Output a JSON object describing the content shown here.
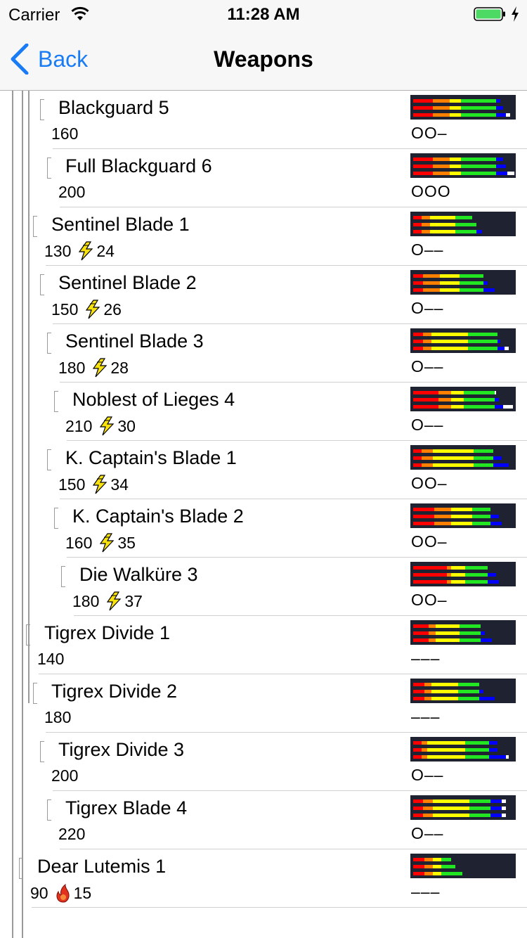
{
  "status_bar": {
    "carrier": "Carrier",
    "time": "11:28 AM"
  },
  "nav": {
    "back_label": "Back",
    "title": "Weapons"
  },
  "sharpness_colors": [
    "#ff0000",
    "#ff7f00",
    "#ffff00",
    "#22e622",
    "#0000ff",
    "#ffffff",
    "#ffffff"
  ],
  "weapons": [
    {
      "name": "",
      "attack": "140",
      "slots": "OO–",
      "indent": 4,
      "bonus_type": "",
      "bonus_value": "",
      "sharpness": [
        [
          0,
          0,
          0,
          0,
          0,
          0
        ],
        [
          0,
          0,
          0,
          0,
          0,
          0
        ],
        [
          0,
          0,
          0,
          0,
          0,
          0
        ]
      ]
    },
    {
      "name": "Blackguard 5",
      "attack": "160",
      "slots": "OO–",
      "indent": 5,
      "bonus_type": "",
      "bonus_value": "",
      "sharpness": [
        [
          28,
          24,
          16,
          50,
          6,
          0
        ],
        [
          28,
          24,
          16,
          50,
          10,
          0
        ],
        [
          28,
          24,
          16,
          50,
          14,
          6
        ]
      ]
    },
    {
      "name": "Full Blackguard 6",
      "attack": "200",
      "slots": "OOO",
      "indent": 6,
      "bonus_type": "",
      "bonus_value": "",
      "sharpness": [
        [
          28,
          24,
          16,
          50,
          10,
          0
        ],
        [
          28,
          24,
          16,
          50,
          14,
          0
        ],
        [
          28,
          24,
          16,
          50,
          16,
          10
        ]
      ]
    },
    {
      "name": "Sentinel Blade 1",
      "attack": "130",
      "slots": "O––",
      "indent": 4,
      "bonus_type": "thunder",
      "bonus_value": "24",
      "sharpness": [
        [
          12,
          12,
          36,
          24,
          0,
          0
        ],
        [
          12,
          12,
          36,
          30,
          0,
          0
        ],
        [
          12,
          12,
          36,
          30,
          8,
          0
        ]
      ]
    },
    {
      "name": "Sentinel Blade 2",
      "attack": "150",
      "slots": "O––",
      "indent": 5,
      "bonus_type": "thunder",
      "bonus_value": "26",
      "sharpness": [
        [
          14,
          24,
          28,
          34,
          0,
          0
        ],
        [
          14,
          24,
          28,
          34,
          6,
          0
        ],
        [
          14,
          24,
          28,
          34,
          16,
          0
        ]
      ]
    },
    {
      "name": "Sentinel Blade 3",
      "attack": "180",
      "slots": "O––",
      "indent": 6,
      "bonus_type": "thunder",
      "bonus_value": "28",
      "sharpness": [
        [
          14,
          12,
          52,
          42,
          0,
          0
        ],
        [
          14,
          12,
          52,
          42,
          4,
          0
        ],
        [
          14,
          12,
          52,
          42,
          10,
          6
        ]
      ]
    },
    {
      "name": "Noblest of Lieges 4",
      "attack": "210",
      "slots": "O––",
      "indent": 7,
      "bonus_type": "thunder",
      "bonus_value": "30",
      "sharpness": [
        [
          36,
          18,
          18,
          44,
          0,
          2
        ],
        [
          36,
          18,
          18,
          44,
          6,
          0
        ],
        [
          36,
          18,
          18,
          44,
          12,
          14
        ]
      ]
    },
    {
      "name": "K. Captain's Blade 1",
      "attack": "150",
      "slots": "OO–",
      "indent": 6,
      "bonus_type": "thunder",
      "bonus_value": "34",
      "sharpness": [
        [
          12,
          16,
          58,
          28,
          0,
          0
        ],
        [
          12,
          16,
          58,
          28,
          12,
          0
        ],
        [
          12,
          16,
          58,
          28,
          22,
          0
        ]
      ]
    },
    {
      "name": "K. Captain's Blade 2",
      "attack": "160",
      "slots": "OO–",
      "indent": 7,
      "bonus_type": "thunder",
      "bonus_value": "35",
      "sharpness": [
        [
          30,
          24,
          30,
          26,
          0,
          0
        ],
        [
          30,
          24,
          30,
          26,
          12,
          0
        ],
        [
          30,
          24,
          30,
          26,
          16,
          0
        ]
      ]
    },
    {
      "name": "Die Walküre 3",
      "attack": "180",
      "slots": "OO–",
      "indent": 8,
      "bonus_type": "thunder",
      "bonus_value": "37",
      "sharpness": [
        [
          48,
          6,
          20,
          32,
          0,
          0
        ],
        [
          48,
          6,
          20,
          32,
          12,
          0
        ],
        [
          48,
          6,
          20,
          32,
          16,
          0
        ]
      ]
    },
    {
      "name": "Tigrex Divide 1",
      "attack": "140",
      "slots": "–––",
      "indent": 3,
      "bonus_type": "",
      "bonus_value": "",
      "sharpness": [
        [
          22,
          10,
          34,
          30,
          0,
          0
        ],
        [
          22,
          10,
          34,
          30,
          6,
          0
        ],
        [
          22,
          10,
          34,
          30,
          16,
          0
        ]
      ]
    },
    {
      "name": "Tigrex Divide 2",
      "attack": "180",
      "slots": "–––",
      "indent": 4,
      "bonus_type": "",
      "bonus_value": "",
      "sharpness": [
        [
          16,
          10,
          38,
          30,
          0,
          0
        ],
        [
          16,
          10,
          38,
          30,
          6,
          0
        ],
        [
          16,
          10,
          38,
          30,
          22,
          0
        ]
      ]
    },
    {
      "name": "Tigrex Divide 3",
      "attack": "200",
      "slots": "O––",
      "indent": 5,
      "bonus_type": "",
      "bonus_value": "",
      "sharpness": [
        [
          12,
          8,
          54,
          34,
          12,
          0
        ],
        [
          12,
          8,
          54,
          34,
          12,
          0
        ],
        [
          12,
          8,
          54,
          34,
          24,
          4
        ]
      ]
    },
    {
      "name": "Tigrex Blade 4",
      "attack": "220",
      "slots": "O––",
      "indent": 6,
      "bonus_type": "",
      "bonus_value": "",
      "sharpness": [
        [
          14,
          14,
          52,
          30,
          16,
          6
        ],
        [
          14,
          14,
          52,
          30,
          16,
          6
        ],
        [
          14,
          14,
          52,
          30,
          16,
          6
        ]
      ]
    },
    {
      "name": "Dear Lutemis 1",
      "attack": "90",
      "slots": "–––",
      "indent": 2,
      "bonus_type": "fire",
      "bonus_value": "15",
      "sharpness": [
        [
          16,
          12,
          12,
          14,
          0,
          0
        ],
        [
          16,
          12,
          12,
          20,
          0,
          0
        ],
        [
          16,
          12,
          12,
          30,
          0,
          0
        ]
      ]
    }
  ]
}
